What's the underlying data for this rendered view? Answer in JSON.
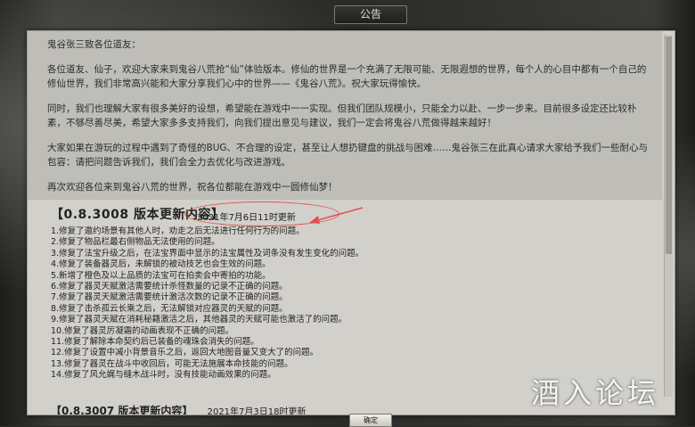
{
  "dialog": {
    "title": "公告",
    "confirm_label": "确定"
  },
  "greeting": {
    "salutation": "鬼谷张三致各位道友：",
    "p1": "各位道友、仙子，欢迎大家来到鬼谷八荒抢“仙”体验版本。修仙的世界是一个充满了无限可能、无限遐想的世界，每个人的心目中都有一个自己的修仙世界，我们非常高兴能和大家分享我们心中的世界——《鬼谷八荒》。祝大家玩得愉快。",
    "p2": "同时，我们也理解大家有很多美好的设想，希望能在游戏中一一实现。但我们团队规模小，只能全力以赴、一步一步来。目前很多设定还比较朴素，不够尽善尽美，希望大家多多支持我们，向我们提出意见与建议，我们一定会将鬼谷八荒做得越来越好！",
    "p3": "大家如果在游玩的过程中遇到了奇怪的BUG、不合理的设定，甚至让人想扔键盘的挑战与困难……鬼谷张三在此真心请求大家给予我们一些耐心与包容：请把问题告诉我们，我们会全力去优化与改进游戏。",
    "p4": "再次欢迎各位来到鬼谷八荒的世界，祝各位都能在游戏中一圆修仙梦！"
  },
  "update": {
    "version": "【0.8.3008 版本更新内容】",
    "date": "2021年7月6日11时更新",
    "changes": [
      "1.修复了邀约场景有其他人时，劝走之后无法进行任何行为的问题。",
      "2.修复了物品栏最右侧物品无法使用的问题。",
      "3.修复了法宝升级之后，在法宝界面中显示的法宝属性及词条没有发生变化的问题。",
      "4.修复了装备器灵后，未解锁的被动技艺也会生效的问题。",
      "5.新增了橙色及以上品质的法宝可在拍卖会中寄拍的功能。",
      "6.修复了器灵天赋激活需要统计杀怪数量的记录不正确的问题。",
      "7.修复了器灵天赋激活需要统计激活次数的记录不正确的问题。",
      "8.修复了击杀孤云长乘之后，无法解锁对应器灵的天赋的问题。",
      "9.修复了器灵天赋在消耗秘籍激活之后，其他器灵的天赋可能也激活了的问题。",
      "10.修复了器灵厉凝霜的动画表现不正确的问题。",
      "11.修复了解除本命契约后已装备的魂珠会消失的问题。",
      "12.修复了设置中减小背景音乐之后，返回大地图音量又变大了的问题。",
      "13.修复了器灵在战斗中收回后，可能无法施展本命技能的问题。",
      "14.修复了风允娓与缝木战斗时，没有技能动画效果的问题。"
    ]
  },
  "update_prev": {
    "version": "【0.8.3007 版本更新内容】",
    "date": "2021年7月3日18时更新"
  },
  "watermark": "酒入论坛",
  "colors": {
    "annotation_red": "#e05252",
    "panel_bg": "#d2d0ca",
    "greeting_bg": "#bebdb7"
  }
}
